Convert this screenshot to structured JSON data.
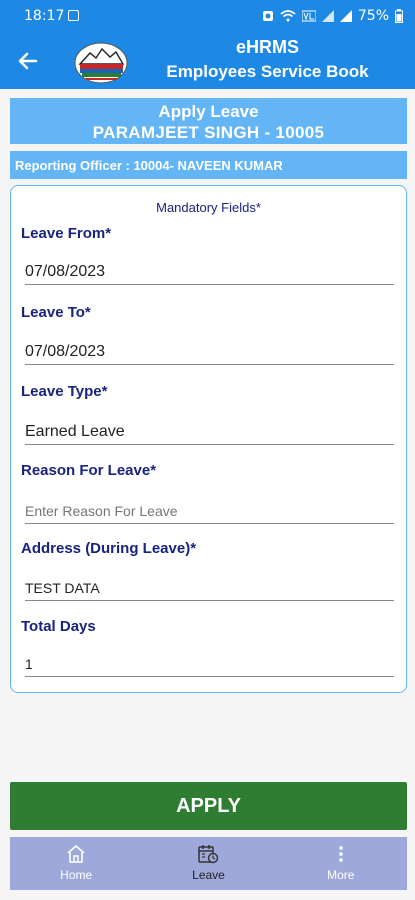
{
  "status_bar": {
    "time": "18:17",
    "battery": "75%"
  },
  "app_bar": {
    "title": "eHRMS",
    "subtitle": "Employees Service Book"
  },
  "header": {
    "line1": "Apply Leave",
    "line2": "PARAMJEET  SINGH - 10005"
  },
  "officer": {
    "text": "Reporting Officer : 10004- NAVEEN  KUMAR"
  },
  "form": {
    "mandatory_note": "Mandatory Fields*",
    "leave_from": {
      "label": "Leave From*",
      "value": "07/08/2023"
    },
    "leave_to": {
      "label": "Leave To*",
      "value": "07/08/2023"
    },
    "leave_type": {
      "label": "Leave Type*",
      "value": "Earned Leave"
    },
    "reason": {
      "label": "Reason For Leave*",
      "placeholder": "Enter Reason For Leave"
    },
    "address": {
      "label": "Address (During Leave)*",
      "value": "TEST DATA"
    },
    "total_days": {
      "label": "Total Days",
      "value": "1"
    }
  },
  "apply_button": "APPLY",
  "nav": {
    "home": "Home",
    "leave": "Leave",
    "more": "More"
  },
  "colors": {
    "primary": "#1e88e5",
    "header_box": "#64b5f6",
    "label_text": "#1a237e",
    "apply_green": "#2e7d32",
    "nav_bg": "#9fa8da"
  }
}
